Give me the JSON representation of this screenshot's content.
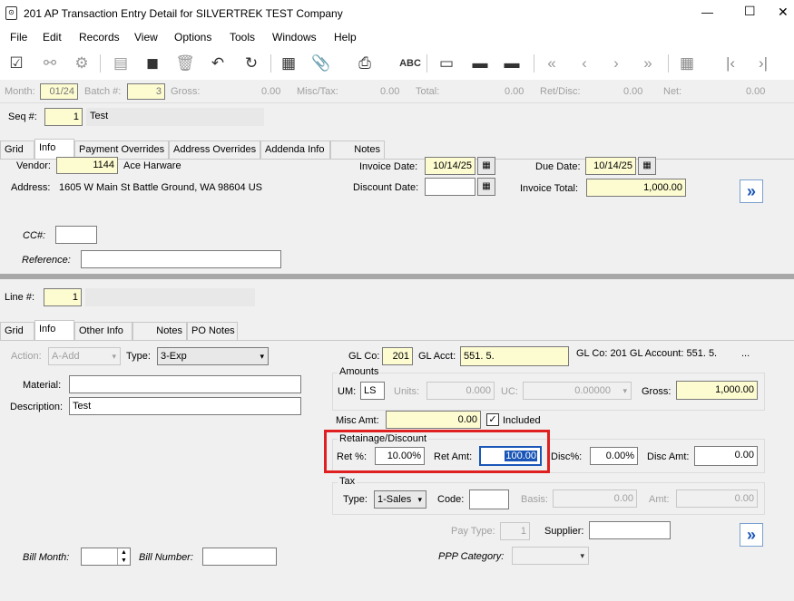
{
  "window": {
    "title": "201 AP Transaction Entry Detail for SILVERTREK TEST Company",
    "minimize": "—",
    "maximize": "☐",
    "close": "✕"
  },
  "menu": [
    "File",
    "Edit",
    "Records",
    "View",
    "Options",
    "Tools",
    "Windows",
    "Help"
  ],
  "summary": {
    "month_label": "Month:",
    "month": "01/24",
    "batch_label": "Batch #:",
    "batch": "3",
    "gross_label": "Gross:",
    "gross": "0.00",
    "misctax_label": "Misc/Tax:",
    "misctax": "0.00",
    "total_label": "Total:",
    "total": "0.00",
    "retdisc_label": "Ret/Disc:",
    "retdisc": "0.00",
    "net_label": "Net:",
    "net": "0.00"
  },
  "header": {
    "seq_label": "Seq #:",
    "seq": "1",
    "seq_desc": "Test",
    "tabs": [
      "Grid",
      "Info",
      "Payment Overrides",
      "Address Overrides",
      "Addenda Info",
      "Notes"
    ],
    "vendor_label": "Vendor:",
    "vendor": "1144",
    "vendor_name": "Ace Harware",
    "address_label": "Address:",
    "address": "1605 W Main St  Battle Ground, WA  98604  US",
    "invoice_date_label": "Invoice Date:",
    "invoice_date": "10/14/25",
    "discount_date_label": "Discount Date:",
    "discount_date": "",
    "due_date_label": "Due Date:",
    "due_date": "10/14/25",
    "invoice_total_label": "Invoice Total:",
    "invoice_total": "1,000.00",
    "cc_label": "CC#:",
    "cc": "",
    "reference_label": "Reference:",
    "reference": ""
  },
  "line": {
    "line_label": "Line #:",
    "line": "1",
    "tabs": [
      "Grid",
      "Info",
      "Other Info",
      "Notes",
      "PO Notes"
    ],
    "action_label": "Action:",
    "action": "A-Add",
    "type_label": "Type:",
    "type": "3-Exp",
    "material_label": "Material:",
    "material": "",
    "description_label": "Description:",
    "description": "Test",
    "glco_label": "GL Co:",
    "glco": "201",
    "glacct_label": "GL Acct:",
    "glacct": "551.  5.",
    "gl_info": "GL Co: 201 GL Account:  551.  5.",
    "gl_more": "...",
    "amounts_title": "Amounts",
    "um_label": "UM:",
    "um": "LS",
    "units_label": "Units:",
    "units": "0.000",
    "uc_label": "UC:",
    "uc": "0.00000",
    "gross_label": "Gross:",
    "gross": "1,000.00",
    "misc_label": "Misc Amt:",
    "misc": "0.00",
    "included_label": "Included",
    "included": true,
    "ret_title": "Retainage/Discount",
    "retpct_label": "Ret %:",
    "retpct": "10.00%",
    "retamt_label": "Ret Amt:",
    "retamt": "100.00",
    "discpct_label": "Disc%:",
    "discpct": "0.00%",
    "discamt_label": "Disc Amt:",
    "discamt": "0.00",
    "tax_title": "Tax",
    "taxtype_label": "Type:",
    "taxtype": "1-Sales",
    "code_label": "Code:",
    "code": "",
    "basis_label": "Basis:",
    "basis": "0.00",
    "amt_label": "Amt:",
    "amt": "0.00",
    "paytype_label": "Pay Type:",
    "paytype": "1",
    "supplier_label": "Supplier:",
    "supplier": "",
    "billmonth_label": "Bill Month:",
    "billmonth": "",
    "billnumber_label": "Bill Number:",
    "billnumber": "",
    "ppp_label": "PPP Category:",
    "ppp": ""
  },
  "colors": {
    "highlight": "#e02020",
    "accent": "#1a56b8",
    "yellow": "#fdfbd0"
  }
}
